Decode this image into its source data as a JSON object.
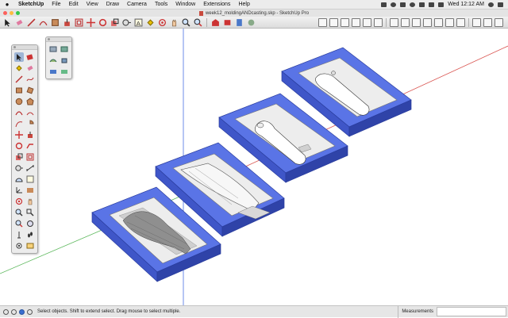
{
  "menubar": {
    "app": "SketchUp",
    "items": [
      "File",
      "Edit",
      "View",
      "Draw",
      "Camera",
      "Tools",
      "Window",
      "Extensions",
      "Help"
    ],
    "clock": "Wed 12:12 AM"
  },
  "window": {
    "title": "week12_moldingANDcasting.skp - SketchUp Pro"
  },
  "statusbar": {
    "hint": "Select objects. Shift to extend select. Drag mouse to select multiple.",
    "measurements_label": "Measurements"
  },
  "colors": {
    "mold_top": "#5a74e6",
    "mold_side": "#3f56c8",
    "mold_front": "#2f43a8",
    "cavity": "#ededed",
    "axis_red": "#d9534f",
    "axis_blue": "#4a6fe3",
    "axis_green": "#5cb85c"
  }
}
